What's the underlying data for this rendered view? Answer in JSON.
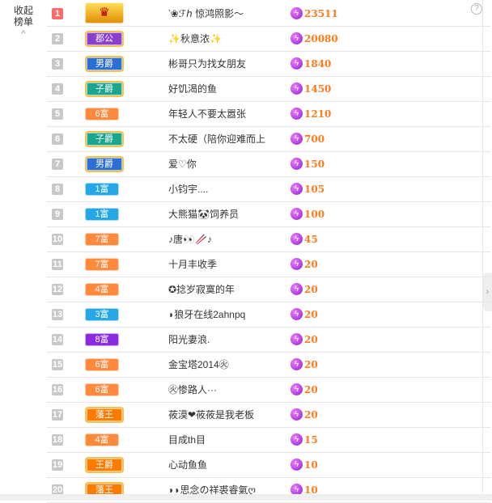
{
  "collapse": {
    "label_line1": "收起",
    "label_line2": "榜单",
    "chevron": "^"
  },
  "help_symbol": "?",
  "right_tab_symbol": "›",
  "colors": {
    "score": "#ff7a1a",
    "rank_top": "#ff6a6a",
    "rank_default": "#c8c8c8",
    "badge_fu": "#ff8a3d",
    "badge_fu_blue": "#25a7e6",
    "badge_fu_purple": "#8a2be2",
    "badge_noble_purple": "#8a3fd1",
    "badge_noble_blue": "#2b6fd6",
    "badge_noble_teal": "#1aa58f",
    "badge_wang": "#ff7a00"
  },
  "rows": [
    {
      "rank": "1",
      "badge": "",
      "badge_type": "crown",
      "name": "‵❀ℱℎ 惊鸿照影～",
      "score": "23511"
    },
    {
      "rank": "2",
      "badge": "郡公",
      "badge_type": "noble-purple",
      "name": "✨秋意浓✨",
      "score": "20080"
    },
    {
      "rank": "3",
      "badge": "男爵",
      "badge_type": "noble-blue",
      "name": "彬哥只为找女朋友",
      "score": "1840"
    },
    {
      "rank": "4",
      "badge": "子爵",
      "badge_type": "noble-teal",
      "name": "好饥渴的鱼",
      "score": "1450"
    },
    {
      "rank": "5",
      "badge": "6富",
      "badge_type": "fu-orange",
      "name": "年轻人不要太嚣张",
      "score": "1210"
    },
    {
      "rank": "6",
      "badge": "子爵",
      "badge_type": "noble-teal",
      "name": "不太硬（陪你迎难而上",
      "score": "700"
    },
    {
      "rank": "7",
      "badge": "男爵",
      "badge_type": "noble-blue",
      "name": "爱♡你",
      "score": "150"
    },
    {
      "rank": "8",
      "badge": "1富",
      "badge_type": "fu-blue",
      "name": "小钧宇....",
      "score": "105"
    },
    {
      "rank": "9",
      "badge": "1富",
      "badge_type": "fu-blue",
      "name": "大熊猫🐼饲养员",
      "score": "100"
    },
    {
      "rank": "10",
      "badge": "7富",
      "badge_type": "fu-orange",
      "name": "♪唐👀🥢♪",
      "score": "45"
    },
    {
      "rank": "11",
      "badge": "7富",
      "badge_type": "fu-orange",
      "name": "十月丰收季",
      "score": "20"
    },
    {
      "rank": "12",
      "badge": "4富",
      "badge_type": "fu-orange",
      "name": "✪捻岁寂寞的年",
      "score": "20"
    },
    {
      "rank": "13",
      "badge": "3富",
      "badge_type": "fu-blue",
      "name": "◗狼牙在线2ahnpq",
      "score": "20"
    },
    {
      "rank": "14",
      "badge": "8富",
      "badge_type": "fu-purple",
      "name": "阳光妻浪.",
      "score": "20"
    },
    {
      "rank": "15",
      "badge": "6富",
      "badge_type": "fu-orange",
      "name": "金宝塔2014㊋",
      "score": "20"
    },
    {
      "rank": "16",
      "badge": "6富",
      "badge_type": "fu-orange",
      "name": "㊋惨路人···",
      "score": "20"
    },
    {
      "rank": "17",
      "badge": "藩王",
      "badge_type": "wang",
      "name": "莜漠❤莜莜是我老板",
      "score": "20"
    },
    {
      "rank": "18",
      "badge": "4富",
      "badge_type": "fu-orange",
      "name": "目成th目",
      "score": "15"
    },
    {
      "rank": "19",
      "badge": "王爵",
      "badge_type": "wang",
      "name": "心动鱼鱼",
      "score": "10"
    },
    {
      "rank": "20",
      "badge": "藩王",
      "badge_type": "wang",
      "name": "◗◗思念の祥裘睿氣ღ",
      "score": "10"
    }
  ]
}
